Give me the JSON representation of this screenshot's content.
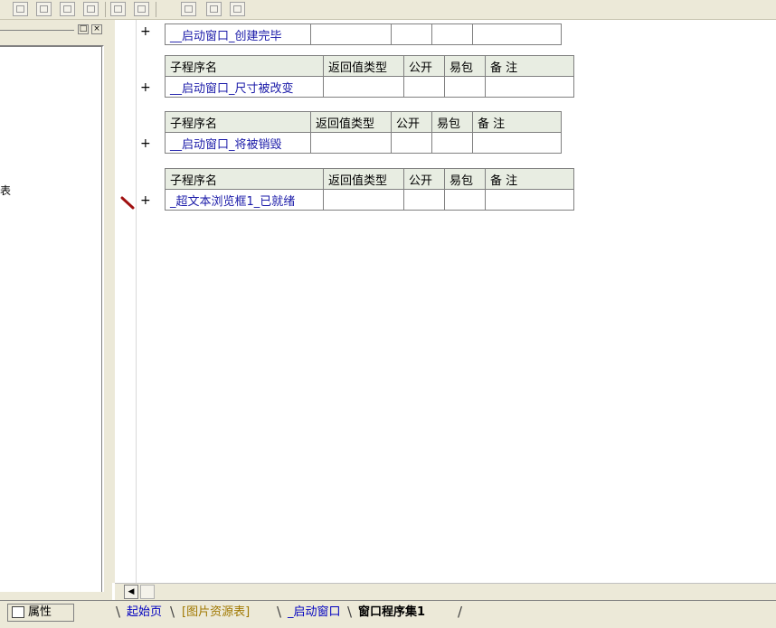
{
  "left_panel": {
    "tree_fragment": "表"
  },
  "icons": {
    "panel_restore": "□",
    "panel_close": "×",
    "scroll_left": "◀",
    "add": "+"
  },
  "subprograms": [
    {
      "show_header": false,
      "name": "__启动窗口_创建完毕"
    },
    {
      "show_header": true,
      "name": "__启动窗口_尺寸被改变"
    },
    {
      "show_header": true,
      "name": "__启动窗口_将被销毁"
    },
    {
      "show_header": true,
      "name": "_超文本浏览框1_已就绪"
    }
  ],
  "headers": {
    "name": "子程序名",
    "return_type": "返回值类型",
    "public": "公开",
    "easy_pack": "易包",
    "remark": "备 注"
  },
  "bottom_bar": {
    "properties_label": "属性",
    "tabs": [
      "起始页",
      "[图片资源表]",
      "_启动窗口",
      "窗口程序集1"
    ]
  }
}
